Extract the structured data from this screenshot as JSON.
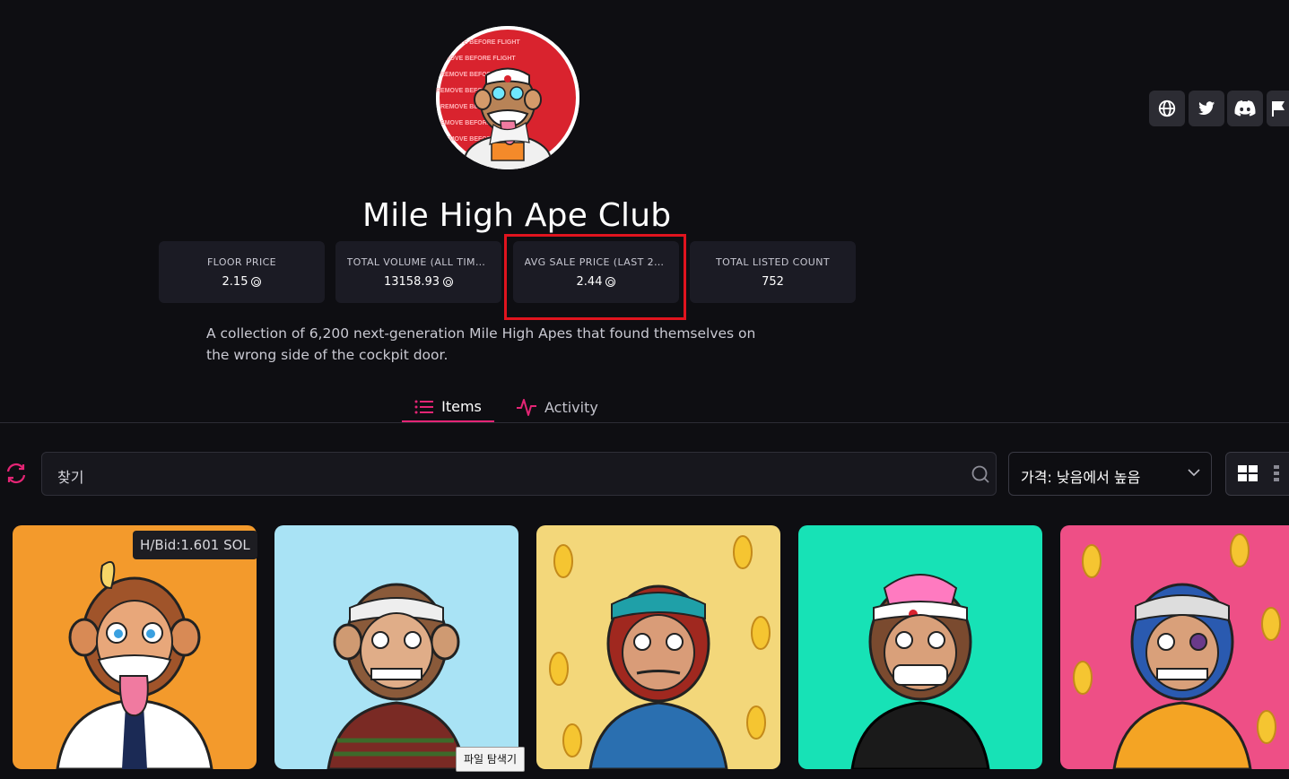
{
  "collection": {
    "name": "Mile High Ape Club",
    "description": "A collection of 6,200 next-generation Mile High Apes that found themselves on the wrong side of the cockpit door.",
    "avatar_banner_text": "REMOVE BEFORE FLIGHT"
  },
  "social": [
    {
      "icon": "globe-icon"
    },
    {
      "icon": "twitter-icon"
    },
    {
      "icon": "discord-icon"
    },
    {
      "icon": "flag-icon"
    }
  ],
  "stats": [
    {
      "label": "FLOOR PRICE",
      "value": "2.15"
    },
    {
      "label": "TOTAL VOLUME (ALL TIME...",
      "value": "13158.93"
    },
    {
      "label": "AVG SALE PRICE (LAST 24...",
      "value": "2.44"
    },
    {
      "label": "TOTAL LISTED COUNT",
      "value": "752"
    }
  ],
  "tabs": [
    {
      "label": "Items",
      "icon": "list-icon",
      "active": true
    },
    {
      "label": "Activity",
      "icon": "activity-icon",
      "active": false
    }
  ],
  "search": {
    "placeholder": "찾기"
  },
  "sort": {
    "selected": "가격: 낮음에서 높음"
  },
  "cards": [
    {
      "bg": "#f39a2c",
      "badge": "H/Bid:1.601 SOL"
    },
    {
      "bg": "#a9e3f5"
    },
    {
      "bg": "#f3d77a"
    },
    {
      "bg": "#17e2b6"
    },
    {
      "bg": "#ee4f86"
    }
  ],
  "tooltip": "파일 탐색기",
  "colors": {
    "accent": "#e42575",
    "highlight": "#e0141e",
    "background": "#0e0e12",
    "card": "#1b1b24"
  }
}
